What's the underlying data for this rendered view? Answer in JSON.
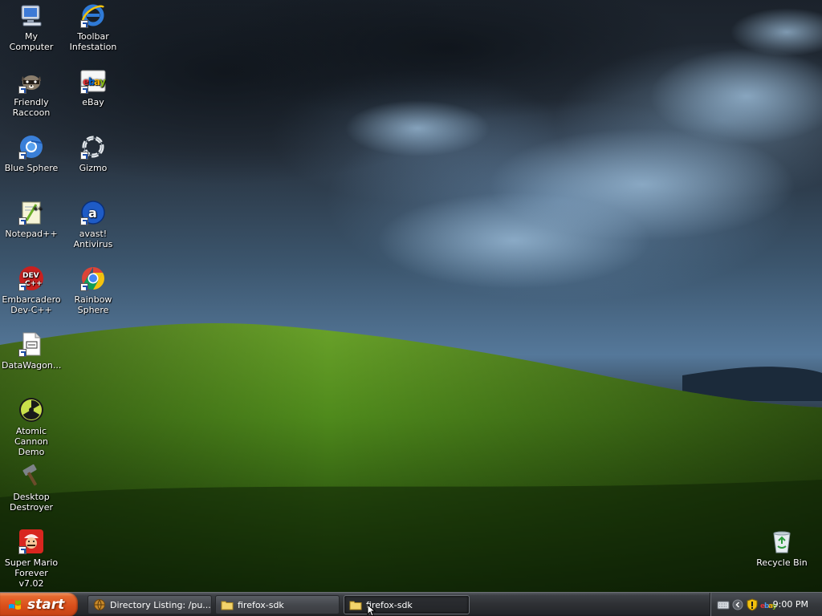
{
  "desktop": {
    "icons": [
      {
        "label": "My Computer",
        "icon": "my-computer-icon"
      },
      {
        "label": "Toolbar Infestation",
        "icon": "internet-explorer-icon"
      },
      {
        "label": "Friendly Raccoon",
        "icon": "raccoon-icon"
      },
      {
        "label": "eBay",
        "icon": "ebay-icon"
      },
      {
        "label": "Blue Sphere",
        "icon": "blue-sphere-icon"
      },
      {
        "label": "Gizmo",
        "icon": "gizmo-ring-icon"
      },
      {
        "label": "Notepad++",
        "icon": "notepad-plus-plus-icon"
      },
      {
        "label": "avast! Antivirus",
        "icon": "avast-icon"
      },
      {
        "label": "Embarcadero Dev-C++",
        "icon": "dev-cpp-icon"
      },
      {
        "label": "Rainbow Sphere",
        "icon": "chrome-icon"
      },
      {
        "label": "DataWagon...",
        "icon": "datawagon-document-icon"
      },
      {
        "label": "Atomic Cannon Demo",
        "icon": "radiation-icon"
      },
      {
        "label": "Desktop Destroyer",
        "icon": "hammer-icon"
      },
      {
        "label": "Super Mario Forever v7.02",
        "icon": "mario-icon"
      },
      {
        "label": "Recycle Bin",
        "icon": "recycle-bin-icon"
      }
    ]
  },
  "taskbar": {
    "start_label": "start",
    "tasks": [
      {
        "label": "Directory Listing: /pu...",
        "icon": "browser-icon",
        "active": false
      },
      {
        "label": "firefox-sdk",
        "icon": "folder-icon",
        "active": false
      },
      {
        "label": "firefox-sdk",
        "icon": "folder-icon",
        "active": true
      }
    ],
    "tray": {
      "icons": [
        "keyboard-icon",
        "show-hidden-icons-chevron",
        "security-shield-icon",
        "ebay-tray-icon"
      ],
      "clock": "9:00 PM"
    }
  },
  "colors": {
    "start_button": "#d94f1b",
    "taskbar": "#2e3034",
    "sky": "#3c566e",
    "hill": "#4f8a1c"
  }
}
